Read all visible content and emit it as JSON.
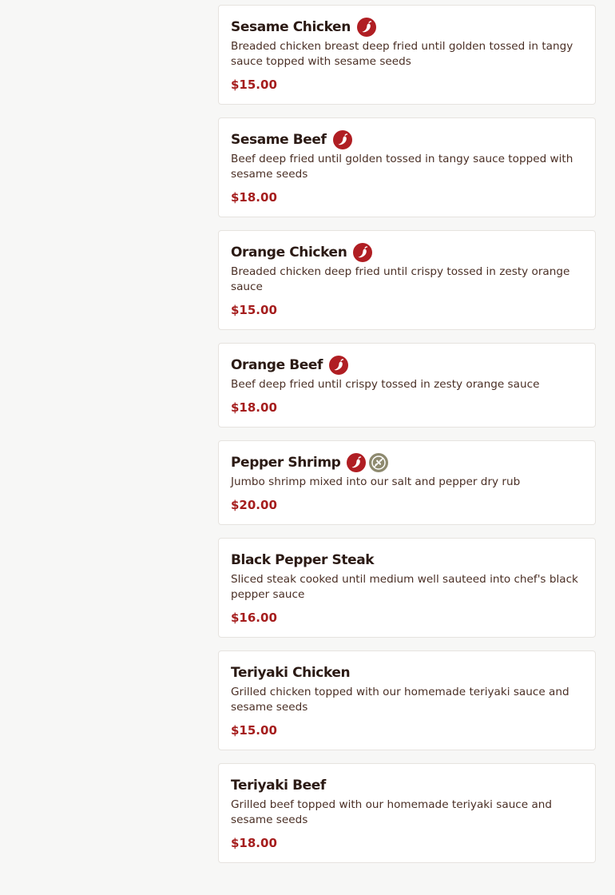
{
  "colors": {
    "page_background": "#f7f7f6",
    "card_background": "#ffffff",
    "price": "#a51d1d",
    "spicy_badge": "#b01e23",
    "gluten_free_badge": "#8e8a6f"
  },
  "menu": {
    "items": [
      {
        "name": "",
        "description": "",
        "price": "$20.00",
        "icons": []
      },
      {
        "name": "Sesame Chicken",
        "description": "Breaded chicken breast deep fried until golden tossed in tangy sauce topped with sesame seeds",
        "price": "$15.00",
        "icons": [
          "spicy-icon"
        ]
      },
      {
        "name": "Sesame Beef",
        "description": "Beef deep fried until golden tossed in tangy sauce topped with sesame seeds",
        "price": "$18.00",
        "icons": [
          "spicy-icon"
        ]
      },
      {
        "name": "Orange Chicken",
        "description": "Breaded chicken deep fried until crispy tossed in zesty orange sauce",
        "price": "$15.00",
        "icons": [
          "spicy-icon"
        ]
      },
      {
        "name": "Orange Beef",
        "description": "Beef deep fried until crispy tossed in zesty orange sauce",
        "price": "$18.00",
        "icons": [
          "spicy-icon"
        ]
      },
      {
        "name": "Pepper Shrimp",
        "description": "Jumbo shrimp mixed into our salt and pepper dry rub",
        "price": "$20.00",
        "icons": [
          "spicy-icon",
          "gluten-free-icon"
        ]
      },
      {
        "name": "Black Pepper Steak",
        "description": "Sliced steak cooked until medium well sauteed into chef's black pepper sauce",
        "price": "$16.00",
        "icons": []
      },
      {
        "name": "Teriyaki Chicken",
        "description": "Grilled chicken topped with our homemade teriyaki sauce and sesame seeds",
        "price": "$15.00",
        "icons": []
      },
      {
        "name": "Teriyaki Beef",
        "description": "Grilled beef topped with our homemade teriyaki sauce and sesame seeds",
        "price": "$18.00",
        "icons": []
      }
    ]
  }
}
